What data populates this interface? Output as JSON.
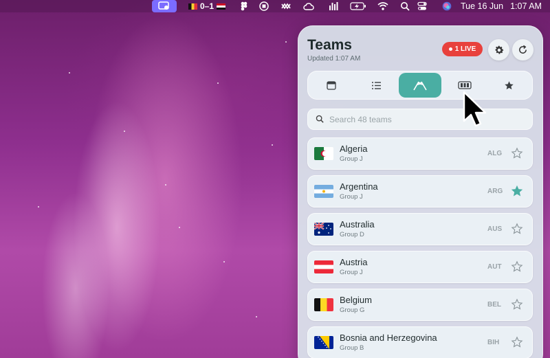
{
  "menubar": {
    "score": "0–1",
    "date": "Tue 16 Jun",
    "time": "1:07 AM"
  },
  "panel": {
    "title": "Teams",
    "updated": "Updated 1:07 AM",
    "live_label": "1 LIVE",
    "accent_color": "#4aaea3",
    "live_color": "#e8413c"
  },
  "tabs": [
    {
      "icon": "calendar-icon",
      "active": false
    },
    {
      "icon": "list-icon",
      "active": false
    },
    {
      "icon": "flags-icon",
      "active": true
    },
    {
      "icon": "bracket-icon",
      "active": false
    },
    {
      "icon": "star-icon",
      "active": false
    }
  ],
  "search": {
    "placeholder": "Search 48 teams"
  },
  "teams": [
    {
      "name": "Algeria",
      "group": "Group J",
      "code": "ALG",
      "favorite": false
    },
    {
      "name": "Argentina",
      "group": "Group J",
      "code": "ARG",
      "favorite": true
    },
    {
      "name": "Australia",
      "group": "Group D",
      "code": "AUS",
      "favorite": false
    },
    {
      "name": "Austria",
      "group": "Group J",
      "code": "AUT",
      "favorite": false
    },
    {
      "name": "Belgium",
      "group": "Group G",
      "code": "BEL",
      "favorite": false
    },
    {
      "name": "Bosnia and Herzegovina",
      "group": "Group B",
      "code": "BIH",
      "favorite": false
    }
  ]
}
